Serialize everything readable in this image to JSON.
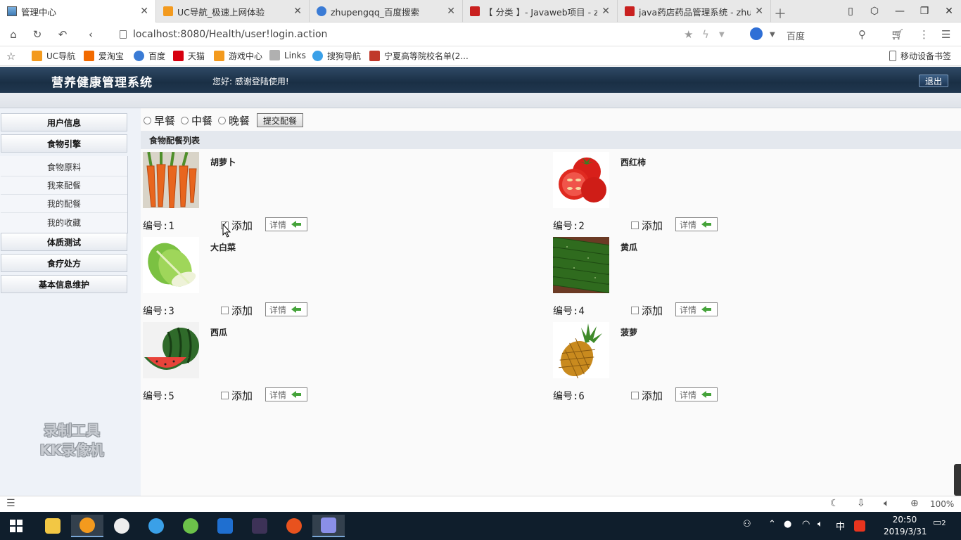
{
  "browser": {
    "tabs": [
      {
        "title": "管理中心",
        "active": true
      },
      {
        "title": "UC导航_极速上网体验",
        "active": false
      },
      {
        "title": "zhupengqq_百度搜索",
        "active": false
      },
      {
        "title": "【 分类 】- Javaweb项目 - z",
        "active": false
      },
      {
        "title": "java药店药品管理系统 - zhup",
        "active": false
      }
    ],
    "address": "localhost:8080/Health/user!login.action",
    "search_engine": "百度"
  },
  "bookmarks": [
    {
      "label": "UC导航",
      "color": "#f39a1e"
    },
    {
      "label": "爱淘宝",
      "color": "#f26a00"
    },
    {
      "label": "百度",
      "color": "#3a7bd5"
    },
    {
      "label": "天猫",
      "color": "#d7000f"
    },
    {
      "label": "游戏中心",
      "color": "#f39a1e"
    },
    {
      "label": "Links",
      "color": "#9a9a9a"
    },
    {
      "label": "搜狗导航",
      "color": "#3aa0e8"
    },
    {
      "label": "宁夏高等院校名单(2...",
      "color": "#c0392b"
    }
  ],
  "bookmarks_right": "移动设备书签",
  "app": {
    "title": "营养健康管理系统",
    "welcome": "您好:  感谢登陆使用!",
    "logout": "退出"
  },
  "sidebar": {
    "menu": [
      {
        "label": "用户信息"
      },
      {
        "label": "食物引擎"
      }
    ],
    "sub": [
      {
        "label": "食物原料"
      },
      {
        "label": "我来配餐"
      },
      {
        "label": "我的配餐"
      },
      {
        "label": "我的收藏"
      }
    ],
    "menu2": [
      {
        "label": "体质测试"
      },
      {
        "label": "食疗处方"
      },
      {
        "label": "基本信息维护"
      }
    ],
    "watermark_line1": "录制工具",
    "watermark_line2": "KK录像机"
  },
  "meals": {
    "options": [
      "早餐",
      "中餐",
      "晚餐"
    ],
    "submit": "提交配餐",
    "list_title": "食物配餐列表"
  },
  "foods": [
    {
      "name": "胡萝卜",
      "no": "编号:1",
      "add": "添加",
      "detail": "详情",
      "checked": true
    },
    {
      "name": "西红柿",
      "no": "编号:2",
      "add": "添加",
      "detail": "详情",
      "checked": false
    },
    {
      "name": "大白菜",
      "no": "编号:3",
      "add": "添加",
      "detail": "详情",
      "checked": false
    },
    {
      "name": "黄瓜",
      "no": "编号:4",
      "add": "添加",
      "detail": "详情",
      "checked": false
    },
    {
      "name": "西瓜",
      "no": "编号:5",
      "add": "添加",
      "detail": "详情",
      "checked": false
    },
    {
      "name": "菠萝",
      "no": "编号:6",
      "add": "添加",
      "detail": "详情",
      "checked": false
    }
  ],
  "statusbar": {
    "zoom": "100%"
  },
  "taskbar": {
    "time": "20:50",
    "date": "2019/3/31",
    "ime": "中",
    "notifications": "2"
  }
}
